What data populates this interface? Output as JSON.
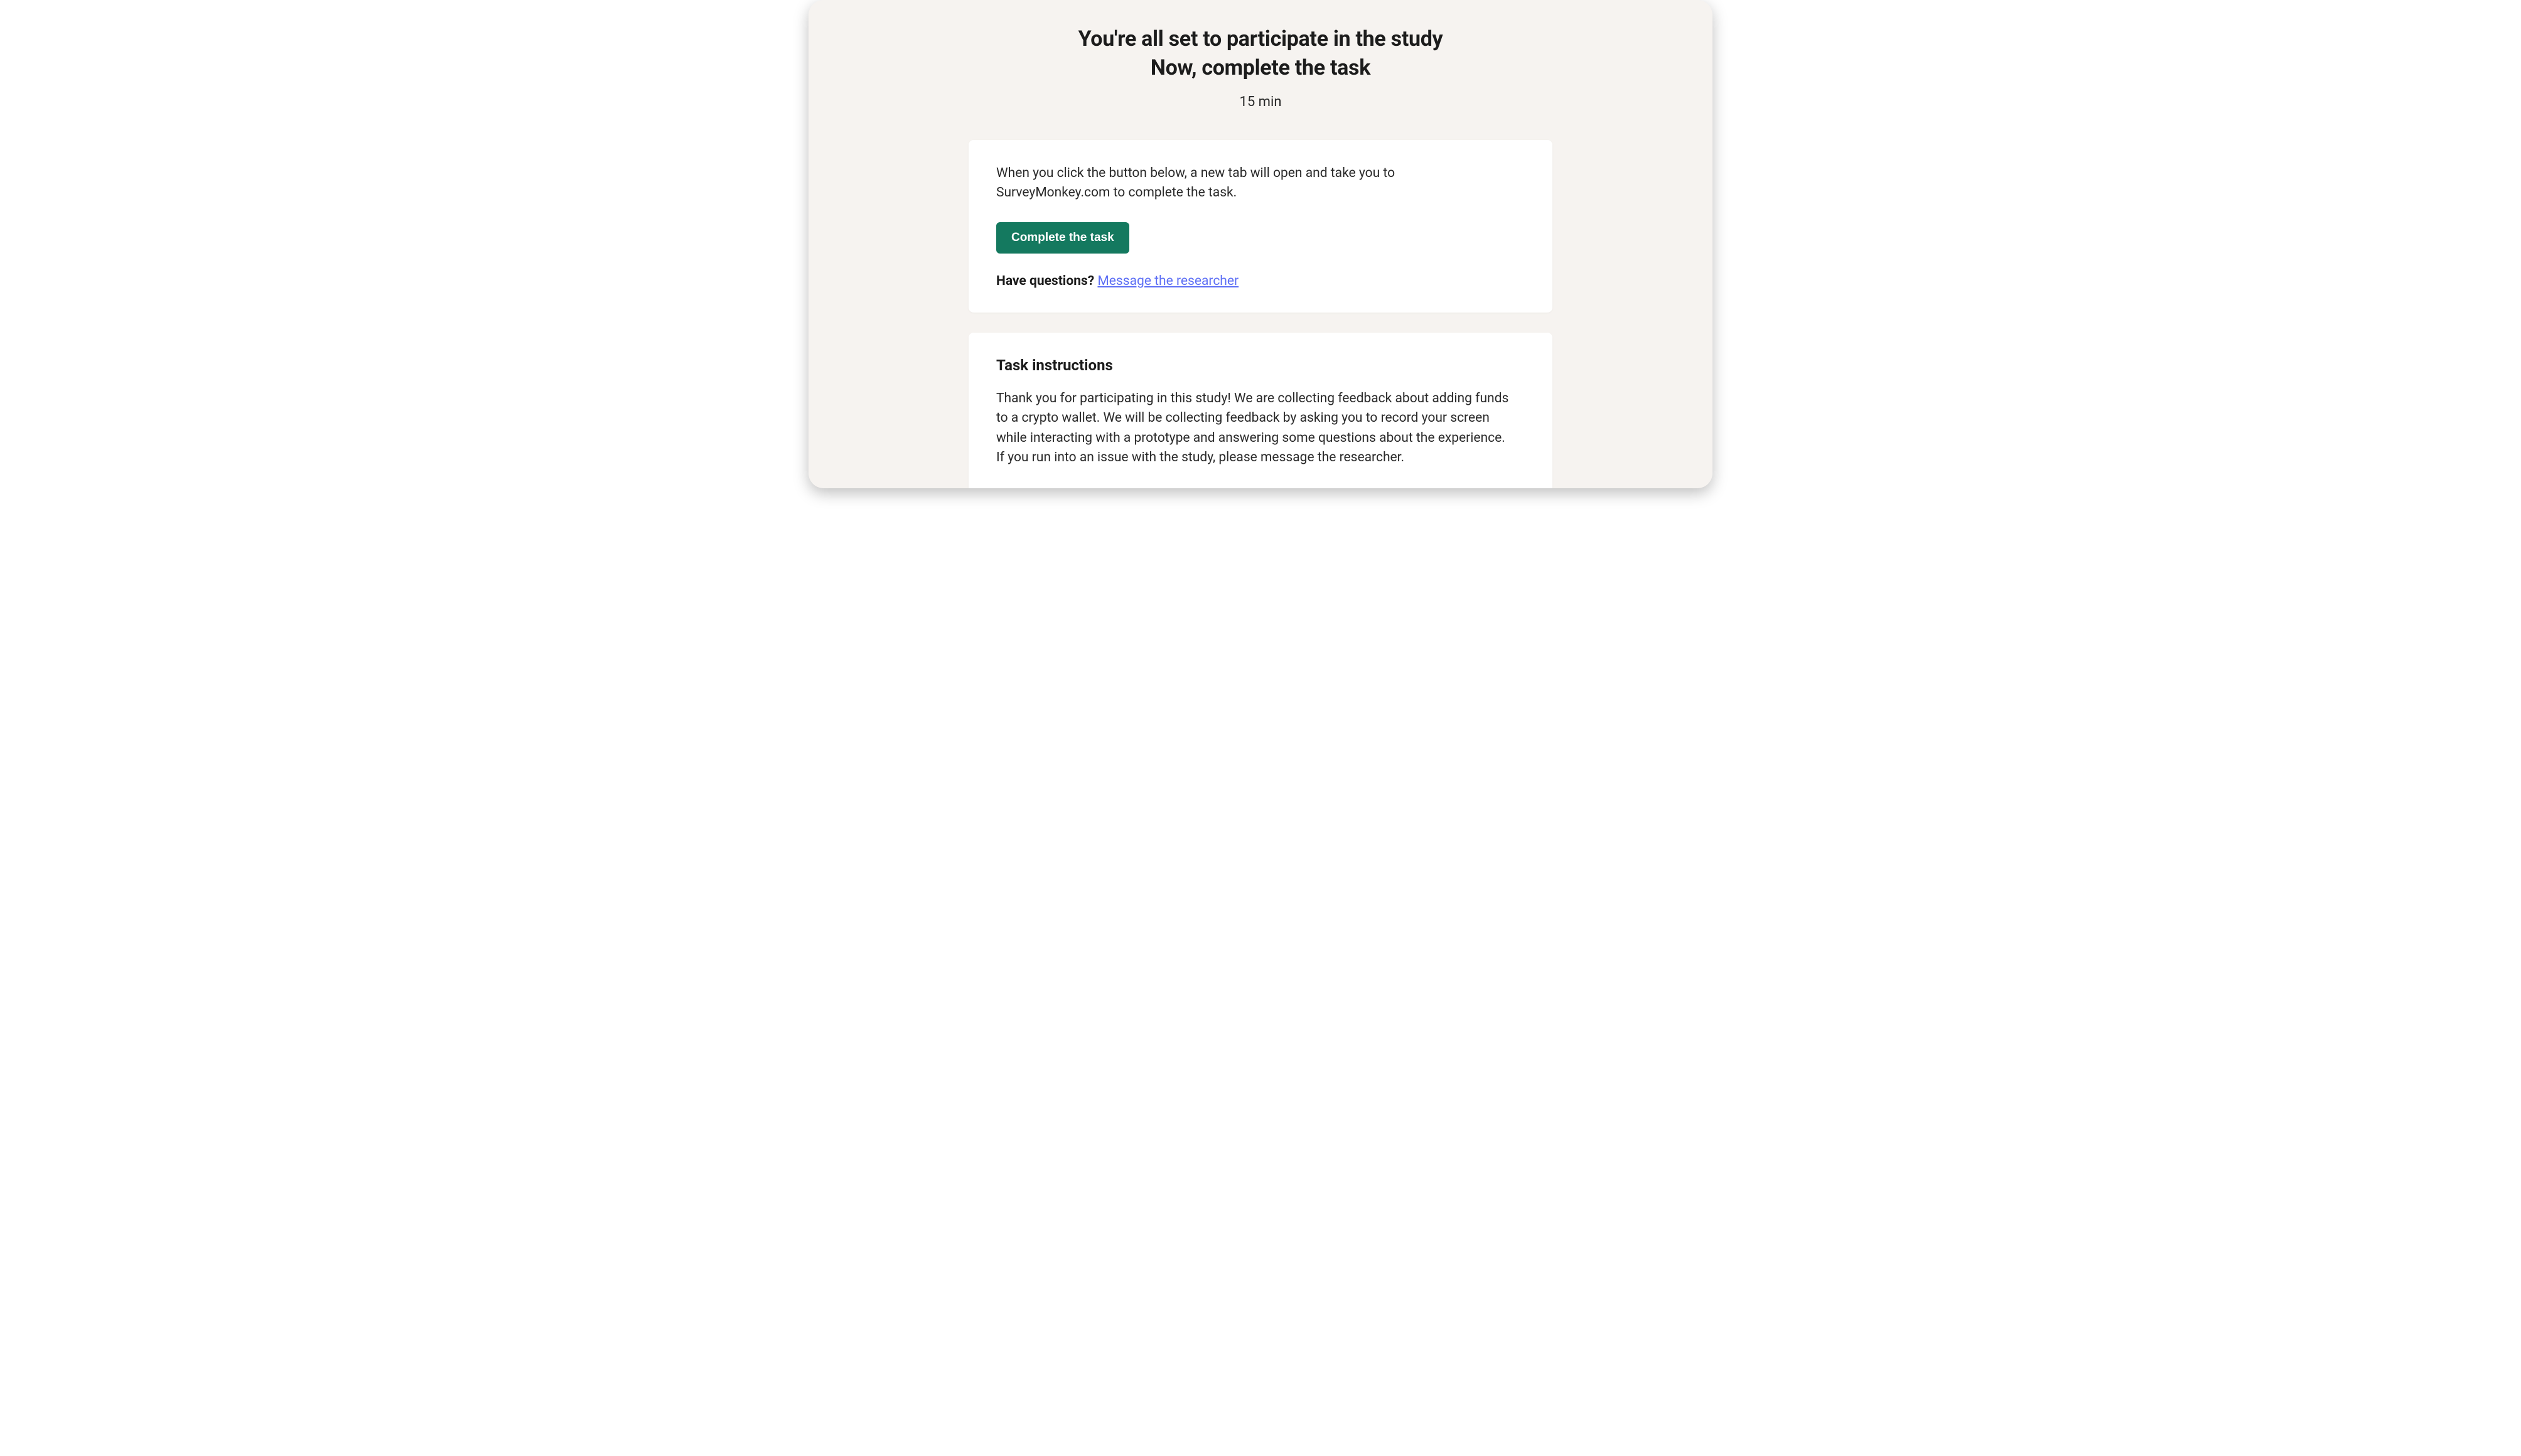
{
  "header": {
    "title_line1": "You're all set to participate in the study",
    "title_line2": "Now, complete the task",
    "duration": "15 min"
  },
  "task_card": {
    "intro": "When you click the button below, a new tab will open and take you to SurveyMonkey.com to complete the task.",
    "button_label": "Complete the task",
    "question_label": "Have questions? ",
    "link_label": "Message the researcher"
  },
  "instructions": {
    "title": "Task instructions",
    "body": "Thank you for participating in this study! We are collecting feedback about adding funds to a crypto wallet. We will be collecting feedback by asking you to record your screen while interacting with a prototype and answering some questions about the experience. If you run into an issue with the study, please message the researcher."
  }
}
